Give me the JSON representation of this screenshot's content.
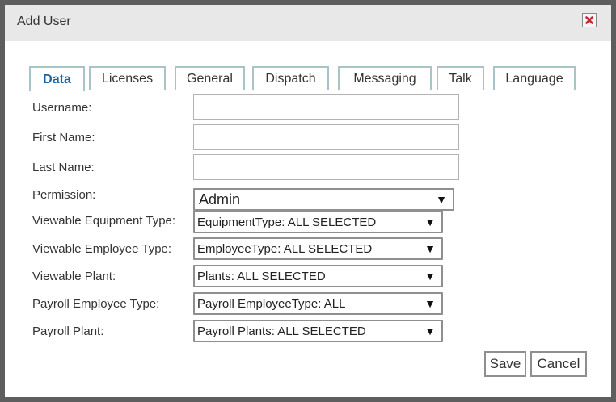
{
  "dialog": {
    "title": "Add User",
    "close_icon": "close-icon"
  },
  "tabs": [
    {
      "label": "Data",
      "active": true
    },
    {
      "label": "Licenses",
      "active": false
    },
    {
      "label": "General",
      "active": false
    },
    {
      "label": "Dispatch",
      "active": false
    },
    {
      "label": "Messaging",
      "active": false
    },
    {
      "label": "Talk",
      "active": false
    },
    {
      "label": "Language",
      "active": false
    }
  ],
  "form": {
    "username": {
      "label": "Username:",
      "value": ""
    },
    "first_name": {
      "label": "First Name:",
      "value": ""
    },
    "last_name": {
      "label": "Last Name:",
      "value": ""
    },
    "permission": {
      "label": "Permission:",
      "value": "Admin"
    },
    "viewable_equipment_type": {
      "label": "Viewable Equipment Type:",
      "value": "EquipmentType: ALL SELECTED"
    },
    "viewable_employee_type": {
      "label": "Viewable Employee Type:",
      "value": "EmployeeType: ALL SELECTED"
    },
    "viewable_plant": {
      "label": "Viewable Plant:",
      "value": "Plants: ALL SELECTED"
    },
    "payroll_employee_type": {
      "label": "Payroll Employee Type:",
      "value": "Payroll EmployeeType: ALL"
    },
    "payroll_plant": {
      "label": "Payroll Plant:",
      "value": "Payroll Plants: ALL SELECTED"
    },
    "dropdown_arrow": "▼"
  },
  "buttons": {
    "save": "Save",
    "cancel": "Cancel"
  },
  "colors": {
    "close_icon": "#c0282d",
    "active_tab_text": "#1565a8"
  }
}
